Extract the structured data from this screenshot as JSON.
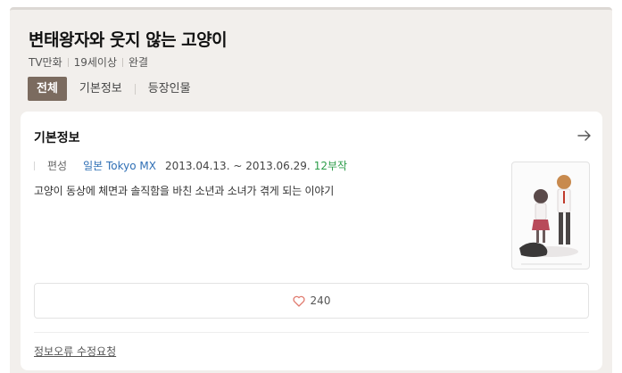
{
  "header": {
    "title": "변태왕자와 웃지 않는 고양이",
    "meta": [
      "TV만화",
      "19세이상",
      "완결"
    ]
  },
  "tabs": [
    {
      "label": "전체",
      "active": true
    },
    {
      "label": "기본정보",
      "active": false
    },
    {
      "label": "등장인물",
      "active": false
    }
  ],
  "info_card": {
    "title": "기본정보",
    "arrow_icon": "arrow-right-icon",
    "broadcast_label": "편성",
    "channel": "일본 Tokyo MX",
    "date_range": "2013.04.13. ~ 2013.06.29.",
    "episodes": "12부작",
    "description": "고양이 동상에 체면과 솔직함을 바친 소년과 소녀가 겪게 되는 이야기",
    "likes": "240",
    "like_icon": "heart-icon",
    "report_link": "정보오류 수정요청"
  },
  "colors": {
    "panel_bg": "#f2efec",
    "tab_active_bg": "#7b6b5f",
    "channel_link": "#2f6fb5",
    "episodes_text": "#2d9d4a",
    "heart": "#e07a6e"
  }
}
